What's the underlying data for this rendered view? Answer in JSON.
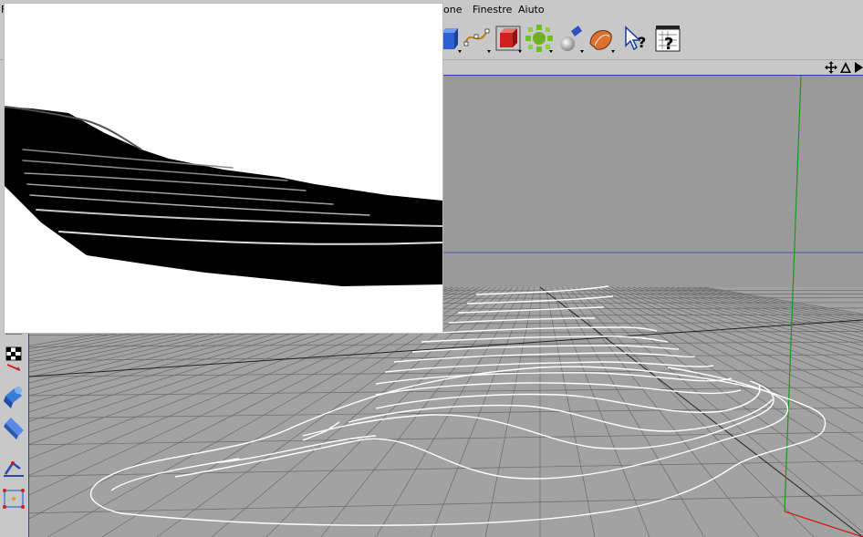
{
  "menubar": {
    "items": [
      {
        "label": "F"
      },
      {
        "label": "ione"
      },
      {
        "label": "Finestre"
      },
      {
        "label": "Aiuto"
      }
    ]
  },
  "toolbar": {
    "tools": [
      {
        "icon": "cube-primitive-icon"
      },
      {
        "icon": "spline-icon"
      },
      {
        "icon": "nurbs-icon"
      },
      {
        "icon": "array-icon"
      },
      {
        "icon": "light-icon"
      },
      {
        "icon": "camera-icon"
      },
      {
        "icon": "pointer-help-icon"
      },
      {
        "icon": "grid-help-icon"
      }
    ]
  },
  "viewport_header": {
    "icons": [
      "move-view-icon",
      "rotate-view-icon",
      "zoom-view-icon"
    ]
  },
  "left_palette": {
    "tools": [
      "checker-tool-icon",
      "checker-arrow-tool-icon",
      "deformer-tool-icon",
      "bevel-tool-icon",
      "ik-tool-icon",
      "points-tool-icon"
    ]
  },
  "colors": {
    "viewport_bg": "#9a9a9a",
    "ui_bg": "#c8c8c8",
    "axis_y": "#1a9a1a",
    "axis_x": "#d01818",
    "horizon": "#3a3ab0",
    "contour": "#ffffff"
  }
}
